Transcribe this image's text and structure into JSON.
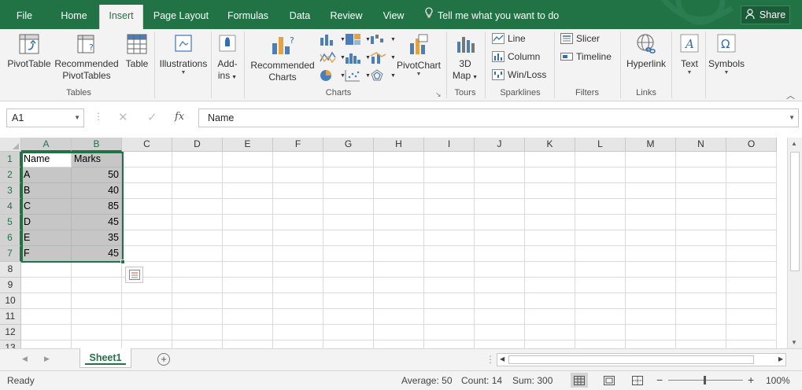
{
  "tabs": [
    {
      "label": "File",
      "active": false
    },
    {
      "label": "Home",
      "active": false
    },
    {
      "label": "Insert",
      "active": true
    },
    {
      "label": "Page Layout",
      "active": false
    },
    {
      "label": "Formulas",
      "active": false
    },
    {
      "label": "Data",
      "active": false
    },
    {
      "label": "Review",
      "active": false
    },
    {
      "label": "View",
      "active": false
    }
  ],
  "tell_me": "Tell me what you want to do",
  "share": "Share",
  "ribbon": {
    "tables": {
      "label": "Tables",
      "pivottable": "PivotTable",
      "recommended_pivottables_1": "Recommended",
      "recommended_pivottables_2": "PivotTables",
      "table": "Table"
    },
    "illustrations": "Illustrations",
    "addins_1": "Add-",
    "addins_2": "ins",
    "charts": {
      "label": "Charts",
      "recommended_1": "Recommended",
      "recommended_2": "Charts",
      "pivotchart": "PivotChart"
    },
    "tours": {
      "label": "Tours",
      "map_1": "3D",
      "map_2": "Map"
    },
    "sparklines": {
      "label": "Sparklines",
      "line": "Line",
      "column": "Column",
      "winloss": "Win/Loss"
    },
    "filters": {
      "label": "Filters",
      "slicer": "Slicer",
      "timeline": "Timeline"
    },
    "links": {
      "label": "Links",
      "hyperlink": "Hyperlink"
    },
    "text": "Text",
    "symbols": "Symbols"
  },
  "formula_bar": {
    "name_box": "A1",
    "cancel": "✕",
    "enter": "✓",
    "fx": "fx",
    "content": "Name"
  },
  "grid": {
    "columns": [
      "A",
      "B",
      "C",
      "D",
      "E",
      "F",
      "G",
      "H",
      "I",
      "J",
      "K",
      "L",
      "M",
      "N",
      "O"
    ],
    "rows": [
      "1",
      "2",
      "3",
      "4",
      "5",
      "6",
      "7",
      "8",
      "9",
      "10",
      "11",
      "12",
      "13"
    ],
    "data": [
      [
        "Name",
        "Marks"
      ],
      [
        "A",
        "50"
      ],
      [
        "B",
        "40"
      ],
      [
        "C",
        "85"
      ],
      [
        "D",
        "45"
      ],
      [
        "E",
        "35"
      ],
      [
        "F",
        "45"
      ]
    ]
  },
  "sheets": [
    {
      "name": "Sheet1",
      "active": true
    }
  ],
  "status": {
    "ready": "Ready",
    "average": "Average: 50",
    "count": "Count: 14",
    "sum": "Sum: 300",
    "zoom": "100%"
  },
  "colors": {
    "accent": "#217346",
    "selection": "#c6c6c6"
  }
}
